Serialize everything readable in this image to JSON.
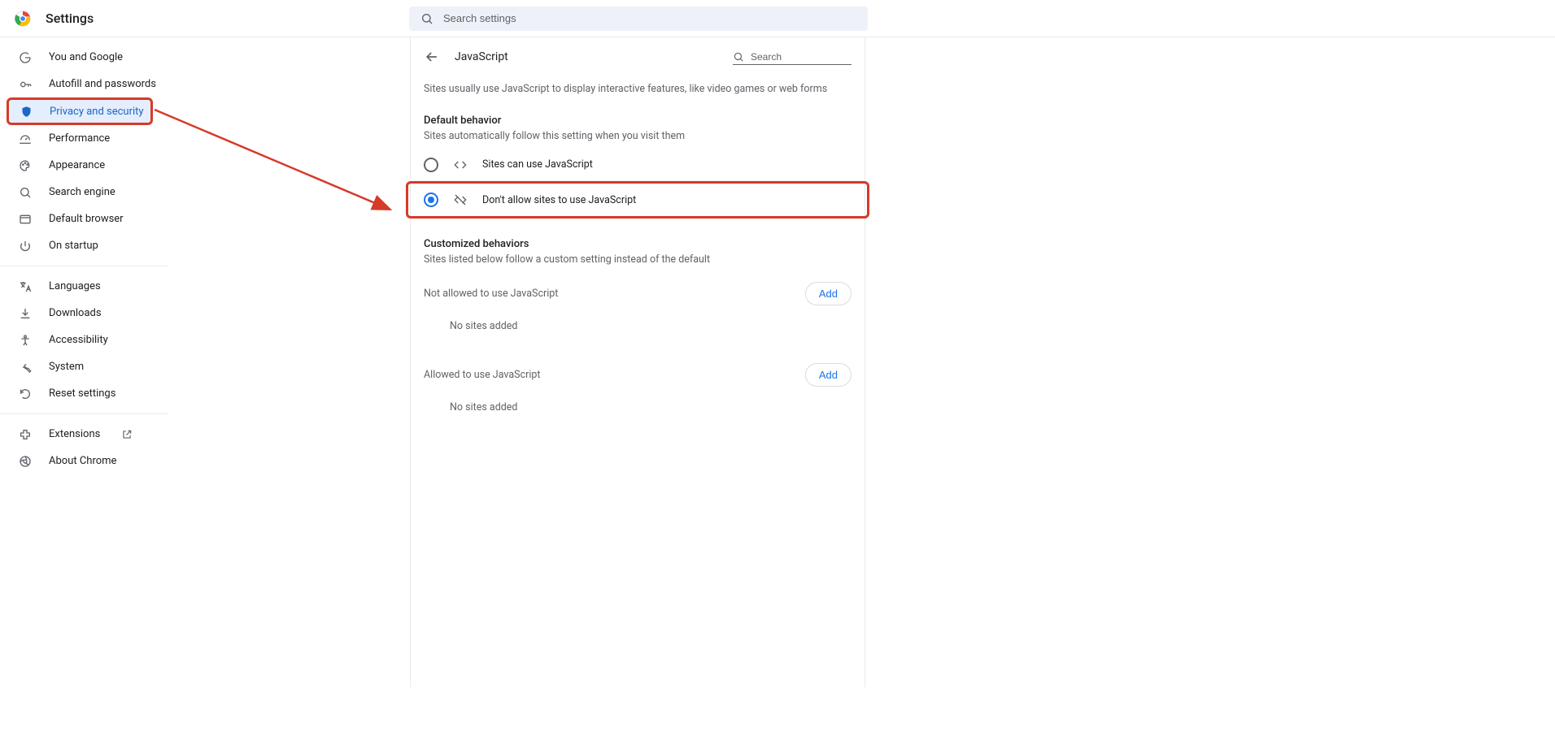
{
  "header": {
    "title": "Settings",
    "search_placeholder": "Search settings"
  },
  "sidebar": {
    "items": [
      {
        "label": "You and Google"
      },
      {
        "label": "Autofill and passwords"
      },
      {
        "label": "Privacy and security"
      },
      {
        "label": "Performance"
      },
      {
        "label": "Appearance"
      },
      {
        "label": "Search engine"
      },
      {
        "label": "Default browser"
      },
      {
        "label": "On startup"
      }
    ],
    "items2": [
      {
        "label": "Languages"
      },
      {
        "label": "Downloads"
      },
      {
        "label": "Accessibility"
      },
      {
        "label": "System"
      },
      {
        "label": "Reset settings"
      }
    ],
    "items3": [
      {
        "label": "Extensions"
      },
      {
        "label": "About Chrome"
      }
    ]
  },
  "main": {
    "title": "JavaScript",
    "search_placeholder": "Search",
    "description": "Sites usually use JavaScript to display interactive features, like video games or web forms",
    "default_behavior": {
      "title": "Default behavior",
      "subtitle": "Sites automatically follow this setting when you visit them",
      "options": [
        {
          "label": "Sites can use JavaScript"
        },
        {
          "label": "Don't allow sites to use JavaScript"
        }
      ]
    },
    "customized": {
      "title": "Customized behaviors",
      "subtitle": "Sites listed below follow a custom setting instead of the default",
      "not_allowed_label": "Not allowed to use JavaScript",
      "allowed_label": "Allowed to use JavaScript",
      "add_button": "Add",
      "no_sites": "No sites added"
    }
  }
}
